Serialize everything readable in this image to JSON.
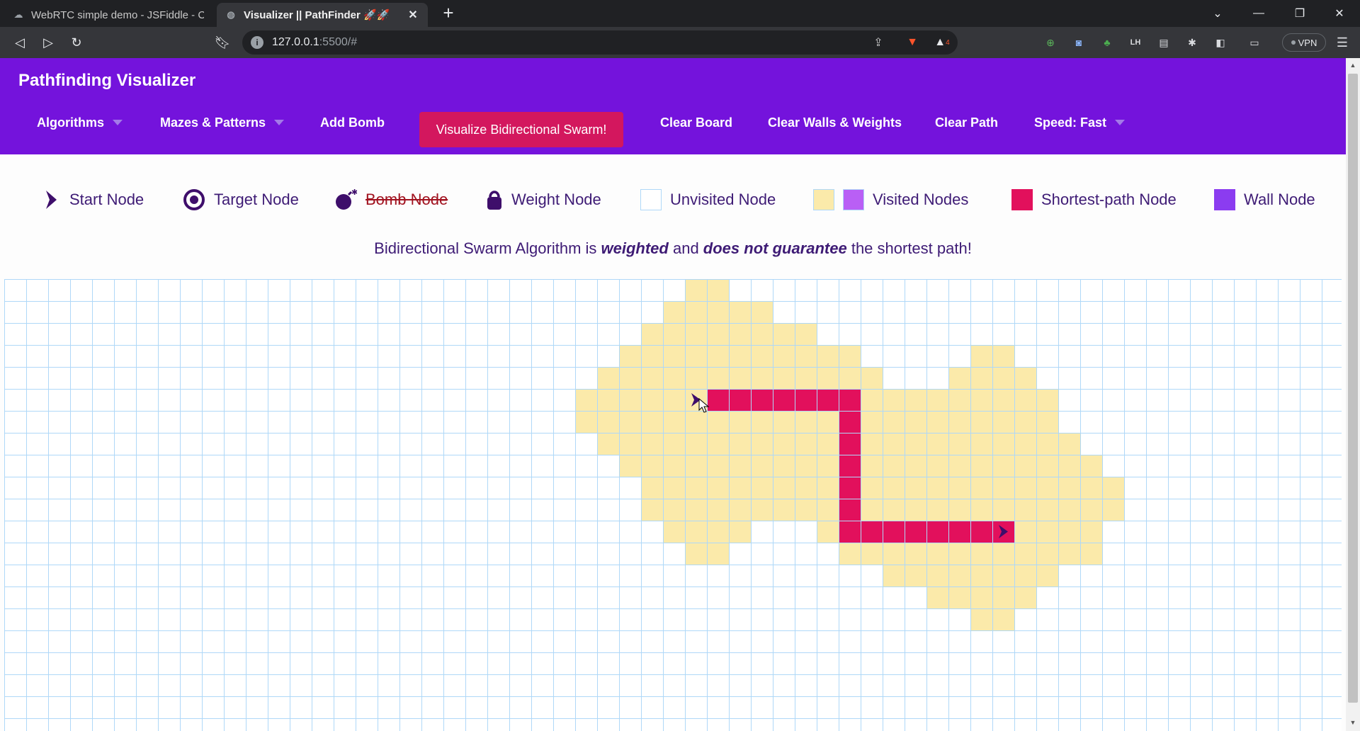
{
  "browser": {
    "tabs": [
      {
        "title": "WebRTC simple demo - JSFiddle - Code",
        "active": false
      },
      {
        "title": "Visualizer || PathFinder 🚀🚀",
        "active": true
      }
    ],
    "url_host": "127.0.0.1",
    "url_path": ":5500/#",
    "vpn_label": "VPN",
    "brave_badge": "4"
  },
  "app": {
    "title": "Pathfinding Visualizer",
    "menu": {
      "algorithms": "Algorithms",
      "mazes": "Mazes & Patterns",
      "add_bomb": "Add Bomb",
      "visualize": "Visualize Bidirectional Swarm!",
      "clear_board": "Clear Board",
      "clear_walls": "Clear Walls & Weights",
      "clear_path": "Clear Path",
      "speed": "Speed: Fast"
    },
    "legend": {
      "start": "Start Node",
      "target": "Target Node",
      "bomb": "Bomb Node",
      "weight": "Weight Node",
      "unvisited": "Unvisited Node",
      "visited": "Visited Nodes",
      "shortest": "Shortest-path Node",
      "wall": "Wall Node"
    },
    "info": {
      "part1": "Bidirectional Swarm Algorithm is ",
      "em1": "weighted",
      "part2": " and ",
      "em2": "does not guarantee",
      "part3": " the shortest path!"
    }
  },
  "colors": {
    "nav": "#7413dc",
    "visualize_button": "#d3175e",
    "visited": "#fbeaaa",
    "visited_alt": "#b95ff5",
    "path": "#e2105c",
    "wall": "#8b3cf0",
    "grid_line": "#afd8f8",
    "node_icon": "#3e0e6b"
  },
  "grid": {
    "cols": 61,
    "rows": 21,
    "visited_runs": [
      [
        0,
        31,
        32
      ],
      [
        1,
        30,
        34
      ],
      [
        2,
        29,
        36
      ],
      [
        3,
        28,
        38
      ],
      [
        3,
        44,
        45
      ],
      [
        4,
        27,
        39
      ],
      [
        4,
        43,
        46
      ],
      [
        5,
        26,
        47
      ],
      [
        6,
        26,
        47
      ],
      [
        7,
        27,
        48
      ],
      [
        8,
        28,
        49
      ],
      [
        9,
        29,
        50
      ],
      [
        10,
        29,
        50
      ],
      [
        11,
        30,
        33
      ],
      [
        11,
        37,
        49
      ],
      [
        12,
        31,
        32
      ],
      [
        12,
        38,
        49
      ],
      [
        13,
        40,
        47
      ],
      [
        14,
        42,
        46
      ],
      [
        15,
        44,
        45
      ]
    ],
    "path_cells": [
      [
        5,
        32
      ],
      [
        5,
        33
      ],
      [
        5,
        34
      ],
      [
        5,
        35
      ],
      [
        5,
        36
      ],
      [
        5,
        37
      ],
      [
        5,
        38
      ],
      [
        6,
        38
      ],
      [
        7,
        38
      ],
      [
        8,
        38
      ],
      [
        9,
        38
      ],
      [
        10,
        38
      ],
      [
        11,
        38
      ],
      [
        11,
        39
      ],
      [
        11,
        40
      ],
      [
        11,
        41
      ],
      [
        11,
        42
      ],
      [
        11,
        43
      ],
      [
        11,
        44
      ],
      [
        11,
        45
      ]
    ],
    "start": [
      5,
      31
    ],
    "target": [
      11,
      45
    ]
  }
}
